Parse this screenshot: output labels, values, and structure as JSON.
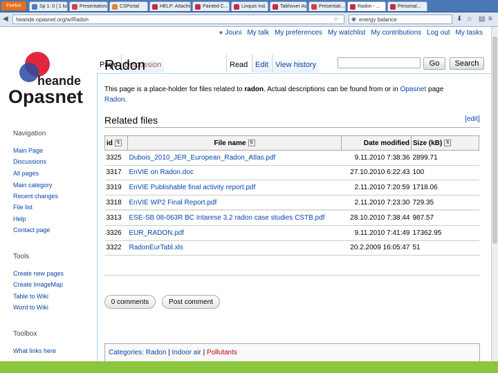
{
  "browser": {
    "firefox_label": "Firefox",
    "tabs": [
      {
        "label": "Sp 1: 0 | 1 ka...",
        "color": "#5577cc"
      },
      {
        "label": "Presentationa...",
        "color": "#cc4444"
      },
      {
        "label": "CSPortal",
        "color": "#dd8833"
      },
      {
        "label": "HELP: Attaching...",
        "color": "#c03040"
      },
      {
        "label": "Painted C...",
        "color": "#c03040"
      },
      {
        "label": "Linquis Ind. C...",
        "color": "#c03040"
      },
      {
        "label": "Tabhover Ass...",
        "color": "#c03040"
      },
      {
        "label": "Presentati...",
        "color": "#cc4444"
      },
      {
        "label": "Radon - ...",
        "color": "#c03040"
      },
      {
        "label": "Personal...",
        "color": "#c03040"
      }
    ],
    "url": "heande.opasnet.org/w/Radon",
    "search_value": "energy balance"
  },
  "personal_links": [
    "Jouni",
    "My talk",
    "My preferences",
    "My watchlist",
    "My contributions",
    "Log out",
    "My tasks"
  ],
  "logo": {
    "line1": "heande",
    "line2": "Opasnet"
  },
  "sidebar": {
    "navigation_heading": "Navigation",
    "navigation": [
      "Main Page",
      "Discussions",
      "All pages",
      "Main category",
      "Recent changes",
      "File list",
      "Help",
      "Contact page"
    ],
    "tools_heading": "Tools",
    "tools": [
      "Create new pages",
      "Create ImageMap",
      "Table to Wiki",
      "Word to Wiki"
    ],
    "toolbox_heading": "Toolbox",
    "toolbox": [
      "What links here"
    ]
  },
  "page_tabs": {
    "page": "Page",
    "discussion": "Discussion",
    "read": "Read",
    "edit": "Edit",
    "history": "View history"
  },
  "search": {
    "go": "Go",
    "search": "Search"
  },
  "title": "Radon",
  "intro": {
    "part1": "This page is a place-holder for files related to ",
    "bold": "radon",
    "part2": ". Actual descriptions can be found from or in ",
    "link1": "Opasnet",
    "part3": " page ",
    "link2": "Radon",
    "part4": "."
  },
  "section": {
    "title": "Related files",
    "edit": "[edit]"
  },
  "table": {
    "headers": [
      "id",
      "File name",
      "Date modified",
      "Size (kB)"
    ],
    "rows": [
      {
        "id": "3325",
        "name": "Dubois_2010_JER_European_Radon_Atlas.pdf",
        "date": "9.11.2010 7:38:36",
        "size": "2899.71"
      },
      {
        "id": "3317",
        "name": "EnVIE on Radon.doc",
        "date": "27.10.2010 6:22:43",
        "size": "100"
      },
      {
        "id": "3319",
        "name": "EnVIE Publishable final activity report.pdf",
        "date": "2.11.2010 7:20:59",
        "size": "1718.06"
      },
      {
        "id": "3318",
        "name": "EnVIE WP2 Final Report.pdf",
        "date": "2.11.2010 7:23:30",
        "size": "729.35"
      },
      {
        "id": "3313",
        "name": "ESE-SB 08-063R BC Intarese 3.2 radon case studies CSTB.pdf",
        "date": "28.10.2010 7:38:44",
        "size": "987.57"
      },
      {
        "id": "3326",
        "name": "EUR_RADON.pdf",
        "date": "9.11.2010 7:41:49",
        "size": "17362.95"
      },
      {
        "id": "3322",
        "name": "RadonEurTabl.xls",
        "date": "20.2.2009 16:05:47",
        "size": "51"
      }
    ]
  },
  "comments": {
    "count_label": "0 comments",
    "post_label": "Post comment"
  },
  "categories": {
    "label": "Categories:",
    "items": [
      "Radon",
      "Indoor air",
      "Pollutants"
    ]
  },
  "colors": {
    "accent_green": "#8cc63e",
    "link": "#0645ad",
    "logo_red": "#e0283c",
    "logo_blue": "#2a4aa0"
  }
}
